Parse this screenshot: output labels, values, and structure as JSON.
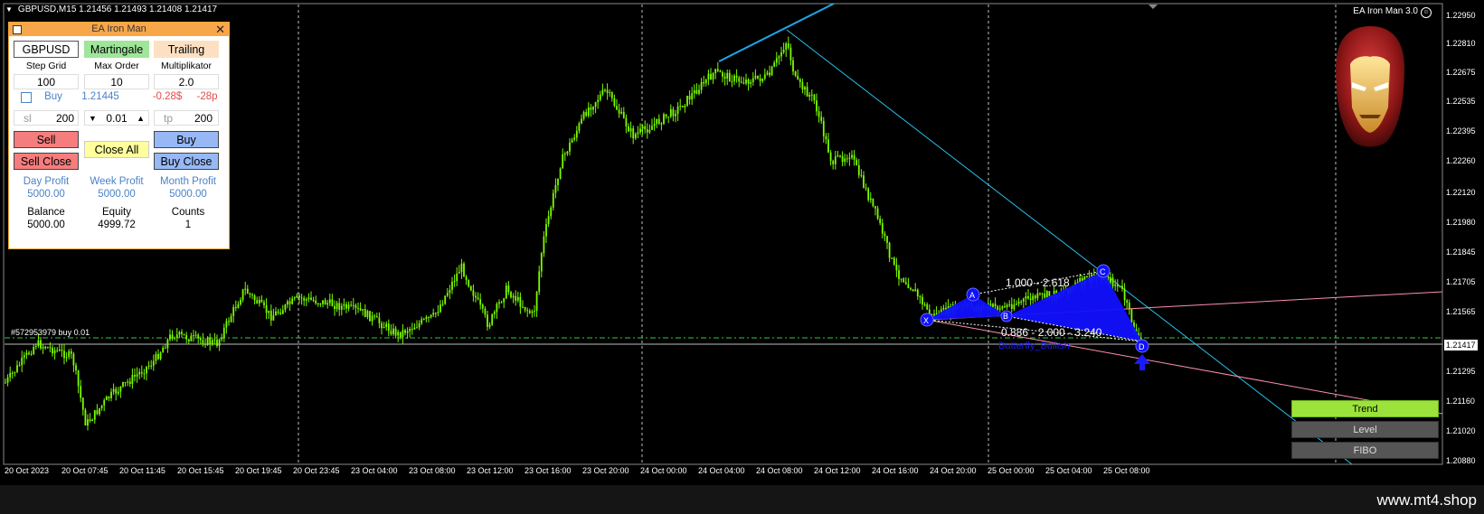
{
  "header": {
    "symbol_info": "GBPUSD,M15  1.21456 1.21493 1.21408 1.21417",
    "ea_name": "EA Iron Man 3.0",
    "ea_icon": "smiley-icon"
  },
  "panel": {
    "title": "EA Iron Man",
    "symbol_btn": "GBPUSD",
    "martingale_btn": "Martingale",
    "trailing_btn": "Trailing",
    "step_grid_label": "Step Grid",
    "max_order_label": "Max Order",
    "multiplikator_label": "Multiplikator",
    "step_grid_value": "100",
    "max_order_value": "10",
    "multiplikator_value": "2.0",
    "buy_label": "Buy",
    "buy_price": "1.21445",
    "pl_money": "-0.28$",
    "pl_points": "-28p",
    "sl_label": "sl",
    "sl_value": "200",
    "lot_value": "0.01",
    "tp_label": "tp",
    "tp_value": "200",
    "sell_btn": "Sell",
    "close_all_btn": "Close All",
    "buy_btn": "Buy",
    "sell_close_btn": "Sell Close",
    "buy_close_btn": "Buy Close",
    "day_profit_label": "Day Profit",
    "day_profit": "5000.00",
    "week_profit_label": "Week Profit",
    "week_profit": "5000.00",
    "month_profit_label": "Month Profit",
    "month_profit": "5000.00",
    "balance_label": "Balance",
    "balance": "5000.00",
    "equity_label": "Equity",
    "equity": "4999.72",
    "counts_label": "Counts",
    "counts": "1"
  },
  "order_line": "#572953979 buy 0.01",
  "pattern": {
    "labels": [
      "1.000 - 2.618",
      "0.886 - 2.000 - 3.240",
      "Butterfly_Bullish"
    ],
    "points": [
      "X",
      "A",
      "B",
      "C",
      "D"
    ]
  },
  "price_axis": [
    "1.22950",
    "1.22810",
    "1.22675",
    "1.22535",
    "1.22395",
    "1.22260",
    "1.22120",
    "1.21980",
    "1.21845",
    "1.21705",
    "1.21565",
    "1.21417",
    "1.21295",
    "1.21160",
    "1.21020",
    "1.20880"
  ],
  "current_price": "1.21417",
  "time_axis": [
    "20 Oct 2023",
    "20 Oct 07:45",
    "20 Oct 11:45",
    "20 Oct 15:45",
    "20 Oct 19:45",
    "20 Oct 23:45",
    "23 Oct 04:00",
    "23 Oct 08:00",
    "23 Oct 12:00",
    "23 Oct 16:00",
    "23 Oct 20:00",
    "24 Oct 00:00",
    "24 Oct 04:00",
    "24 Oct 08:00",
    "24 Oct 12:00",
    "24 Oct 16:00",
    "24 Oct 20:00",
    "25 Oct 00:00",
    "25 Oct 04:00",
    "25 Oct 08:00"
  ],
  "side_buttons": {
    "trend": "Trend",
    "level": "Level",
    "fibo": "FIBO"
  },
  "watermark": "www.mt4.shop",
  "colors": {
    "candle": "#7cfc00",
    "panel_border": "#f3a53a",
    "trend_line": "#1ea7e6",
    "pattern_fill": "#0000ff",
    "pink_line": "#ff8fb0",
    "grid": "#ffffff"
  }
}
